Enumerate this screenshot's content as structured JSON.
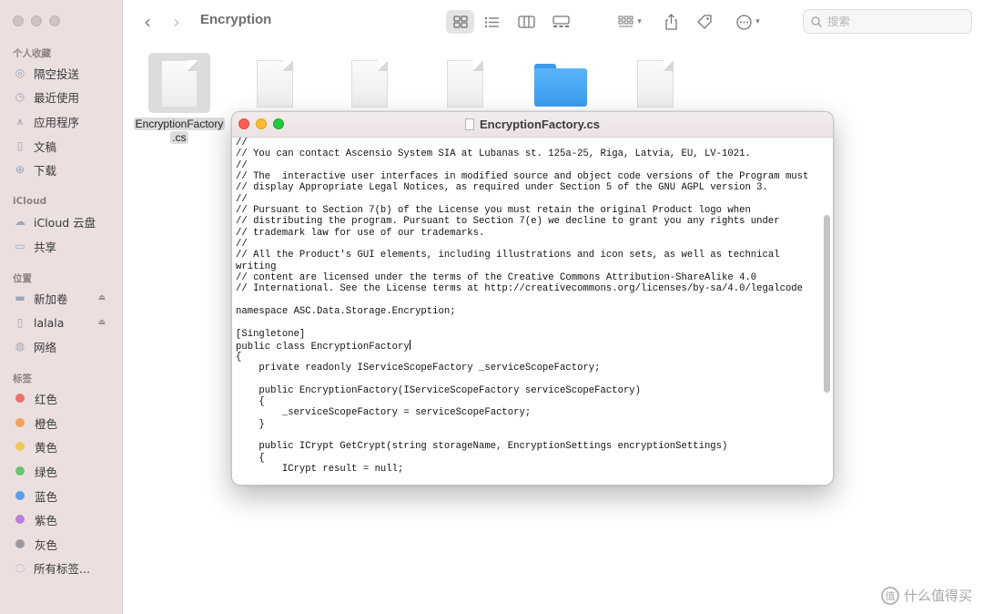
{
  "sidebar": {
    "sections": [
      {
        "header": "个人收藏",
        "items": [
          {
            "label": "隔空投送",
            "icon": "airdrop-icon"
          },
          {
            "label": "最近使用",
            "icon": "clock-icon"
          },
          {
            "label": "应用程序",
            "icon": "applications-icon"
          },
          {
            "label": "文稿",
            "icon": "document-icon"
          },
          {
            "label": "下载",
            "icon": "download-icon"
          }
        ]
      },
      {
        "header": "iCloud",
        "items": [
          {
            "label": "iCloud 云盘",
            "icon": "cloud-icon"
          },
          {
            "label": "共享",
            "icon": "shared-folder-icon"
          }
        ]
      },
      {
        "header": "位置",
        "items": [
          {
            "label": "新加卷",
            "icon": "disk-icon"
          },
          {
            "label": "lalala",
            "icon": "document-icon"
          },
          {
            "label": "网络",
            "icon": "network-icon"
          }
        ]
      },
      {
        "header": "标签",
        "items": [
          {
            "label": "红色",
            "color": "#e8726b"
          },
          {
            "label": "橙色",
            "color": "#f0a35e"
          },
          {
            "label": "黄色",
            "color": "#ecc85a"
          },
          {
            "label": "绿色",
            "color": "#6ac46e"
          },
          {
            "label": "蓝色",
            "color": "#5a9bea"
          },
          {
            "label": "紫色",
            "color": "#b77fd6"
          },
          {
            "label": "灰色",
            "color": "#9a9a9a"
          },
          {
            "label": "所有标签...",
            "icon": "all-tags-icon"
          }
        ]
      }
    ]
  },
  "toolbar": {
    "title": "Encryption",
    "search_placeholder": "搜索"
  },
  "files": {
    "selected_label_line1": "EncryptionFactory",
    "selected_label_line2": ".cs"
  },
  "editor": {
    "title": "EncryptionFactory.cs",
    "code_lines": [
      "//",
      "// You can contact Ascensio System SIA at Lubanas st. 125a-25, Riga, Latvia, EU, LV-1021.",
      "//",
      "// The  interactive user interfaces in modified source and object code versions of the Program must",
      "// display Appropriate Legal Notices, as required under Section 5 of the GNU AGPL version 3.",
      "//",
      "// Pursuant to Section 7(b) of the License you must retain the original Product logo when",
      "// distributing the program. Pursuant to Section 7(e) we decline to grant you any rights under",
      "// trademark law for use of our trademarks.",
      "//",
      "// All the Product's GUI elements, including illustrations and icon sets, as well as technical",
      "writing",
      "// content are licensed under the terms of the Creative Commons Attribution-ShareAlike 4.0",
      "// International. See the License terms at http://creativecommons.org/licenses/by-sa/4.0/legalcode",
      "",
      "namespace ASC.Data.Storage.Encryption;",
      "",
      "[Singletone]",
      "public class EncryptionFactory",
      "{",
      "    private readonly IServiceScopeFactory _serviceScopeFactory;",
      "",
      "    public EncryptionFactory(IServiceScopeFactory serviceScopeFactory)",
      "    {",
      "        _serviceScopeFactory = serviceScopeFactory;",
      "    }",
      "",
      "    public ICrypt GetCrypt(string storageName, EncryptionSettings encryptionSettings)",
      "    {",
      "        ICrypt result = null;"
    ]
  },
  "watermark": {
    "text": "什么值得买"
  }
}
